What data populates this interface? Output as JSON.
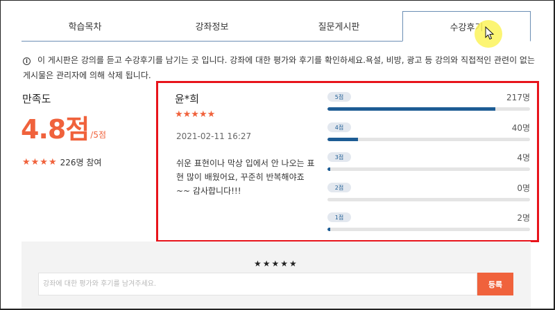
{
  "tabs": [
    {
      "label": "학습목차",
      "active": false
    },
    {
      "label": "강좌정보",
      "active": false
    },
    {
      "label": "질문게시판",
      "active": false
    },
    {
      "label": "수강후기",
      "active": true
    }
  ],
  "notice": {
    "icon": "info-icon",
    "text": "이 게시판은 강의를 듣고 수강후기를 남기는 곳 입니다. 강좌에 대한 평가와 후기를 확인하세요.욕설, 비방, 광고 등 강의와 직접적인 관련이 없는 게시물은 관리자에 의해 삭제 됩니다."
  },
  "satisfaction": {
    "title": "만족도",
    "score": "4.8점",
    "score_max": "/5점",
    "stars": "★★★★",
    "participants": "226명 참여"
  },
  "review": {
    "name": "윤*희",
    "stars": "★★★★★",
    "date": "2021-02-11 16:27",
    "text": "쉬운 표현이나 막상 입에서 안 나오는 표현 많이 배웠어요, 꾸준히 반복해야죠~~ 감사합니다!!!"
  },
  "rating_bars": [
    {
      "label": "5점",
      "count": "217명",
      "fraction": 0.83
    },
    {
      "label": "4점",
      "count": "40명",
      "fraction": 0.15
    },
    {
      "label": "3점",
      "count": "4명",
      "fraction": 0.015
    },
    {
      "label": "2점",
      "count": "0명",
      "fraction": 0
    },
    {
      "label": "1점",
      "count": "2명",
      "fraction": 0.008
    }
  ],
  "form": {
    "stars": "★★★★★",
    "placeholder": "강좌에 대한 평가와 후기를 남겨주세요.",
    "submit_label": "등록"
  },
  "colors": {
    "accent": "#f0623c",
    "bar": "#1d5c94",
    "highlight_box": "#e8141b"
  }
}
